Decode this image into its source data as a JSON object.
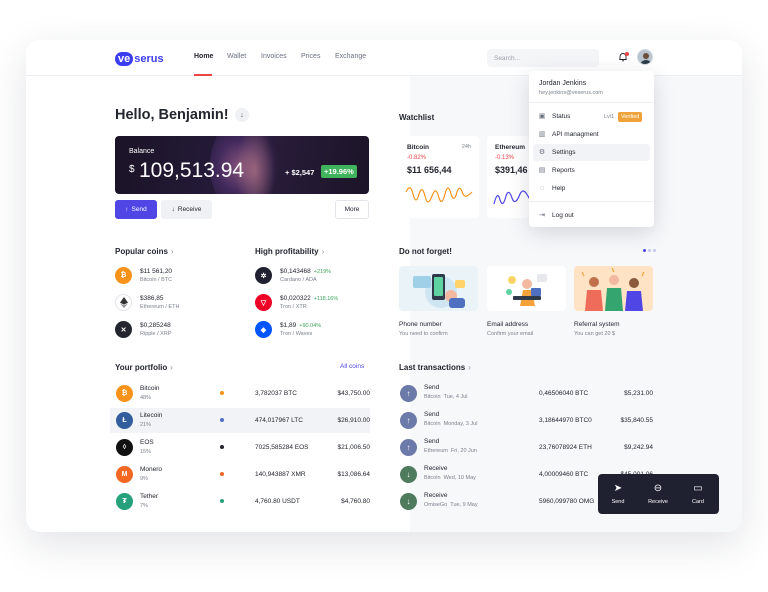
{
  "brand": {
    "logo_badge": "ve",
    "logo_rest": "serus",
    "accent": "#4f46e5"
  },
  "nav": {
    "items": [
      "Home",
      "Wallet",
      "Invoices",
      "Prices",
      "Exchange"
    ],
    "active": "Home"
  },
  "search": {
    "placeholder": "Search..."
  },
  "greeting": "Hello, Benjamin!",
  "balance": {
    "label": "Balance",
    "currency": "$",
    "amount": "109,513.94",
    "change": "+ $2,547",
    "change_pct": "+19.96%"
  },
  "actions": {
    "send": "Send",
    "receive": "Receive",
    "more": "More"
  },
  "popular": {
    "title": "Popular coins",
    "items": [
      {
        "value": "$11 561,20",
        "sub": "Bitcoin / BTC",
        "icon": "bitcoin-icon",
        "color": "#f7931a"
      },
      {
        "value": "$386,85",
        "sub": "Ethereum / ETH",
        "icon": "ethereum-icon",
        "color": "#ffffff"
      },
      {
        "value": "$0,285248",
        "sub": "Ripple / XRP",
        "icon": "ripple-icon",
        "color": "#23262f"
      }
    ]
  },
  "high_profit": {
    "title": "High profitability",
    "items": [
      {
        "value": "$0,143468",
        "gain": "+219%",
        "sub": "Cardano / ADA",
        "icon": "cardano-icon",
        "color": "#1f2130"
      },
      {
        "value": "$0,020322",
        "gain": "+118.16%",
        "sub": "Tron / XTR",
        "icon": "tron-icon",
        "color": "#ef0027"
      },
      {
        "value": "$1,89",
        "gain": "+90.04%",
        "sub": "Tron / Waves",
        "icon": "waves-icon",
        "color": "#0055ff"
      }
    ]
  },
  "portfolio": {
    "title": "Your portfolio",
    "all_link": "All coins",
    "rows": [
      {
        "name": "Bitcoin",
        "pct": "48%",
        "amount": "3,782037 BTC",
        "usd": "$43,750.00",
        "color": "#f7931a",
        "glyph": "₿"
      },
      {
        "name": "Litecoin",
        "pct": "21%",
        "amount": "474,017967 LTC",
        "usd": "$26,910.00",
        "color": "#345d9d",
        "glyph": "Ł"
      },
      {
        "name": "EOS",
        "pct": "15%",
        "amount": "7025,585284 EOS",
        "usd": "$21,006.50",
        "color": "#111111",
        "glyph": "◊"
      },
      {
        "name": "Monero",
        "pct": "9%",
        "amount": "140,943887 XMR",
        "usd": "$13,086.64",
        "color": "#f26822",
        "glyph": "M"
      },
      {
        "name": "Tether",
        "pct": "7%",
        "amount": "4,760.80 USDT",
        "usd": "$4,760.80",
        "color": "#26a17b",
        "glyph": "₮"
      }
    ]
  },
  "watchlist": {
    "title": "Watchlist",
    "cards": [
      {
        "name": "Bitcoin",
        "period": "24h",
        "change": "-0.82%",
        "price": "$11 656,44",
        "line_color": "#f7931a"
      },
      {
        "name": "Ethereum",
        "period": "",
        "change": "-0.13%",
        "price": "$391,46",
        "line_color": "#4f46e5"
      }
    ]
  },
  "dnf": {
    "title": "Do not forget!",
    "cards": [
      {
        "label": "Phone number",
        "sub": "You need to confirm"
      },
      {
        "label": "Email address",
        "sub": "Confirm your email"
      },
      {
        "label": "Referral system",
        "sub": "You can get 20 $"
      }
    ]
  },
  "transactions": {
    "title": "Last transactions",
    "rows": [
      {
        "type": "Send",
        "coin": "Bitcoin",
        "date": "Tue, 4 Jul",
        "amount": "0,46506040 BTC",
        "usd": "$5,231.00",
        "dir": "up"
      },
      {
        "type": "Send",
        "coin": "Bitcoin",
        "date": "Monday, 3 Jul",
        "amount": "3,18644970 BTC0",
        "usd": "$35,840.55",
        "dir": "up"
      },
      {
        "type": "Send",
        "coin": "Ethereum",
        "date": "Fri, 20 Jun",
        "amount": "23,76078924 ETH",
        "usd": "$9,242.94",
        "dir": "up"
      },
      {
        "type": "Receive",
        "coin": "Bitcoin",
        "date": "Wed, 10 May",
        "amount": "4,00009460 BTC",
        "usd": "$45,001.06",
        "dir": "down"
      },
      {
        "type": "Receive",
        "coin": "OmiseGo",
        "date": "Tue, 9 May",
        "amount": "5960,099780 OMG",
        "usd": "",
        "dir": "down"
      }
    ]
  },
  "profile": {
    "name": "Jordan Jenkins",
    "email": "hey.jenkins@veserus.com",
    "menu": [
      {
        "label": "Status",
        "icon": "status-icon",
        "level": "Lvl1",
        "badge": "Verified"
      },
      {
        "label": "API managment",
        "icon": "api-icon"
      },
      {
        "label": "Settings",
        "icon": "gear-icon"
      },
      {
        "label": "Reports",
        "icon": "reports-icon"
      },
      {
        "label": "Help",
        "icon": "help-icon"
      },
      {
        "label": "Log out",
        "icon": "logout-icon"
      }
    ]
  },
  "action_bar": {
    "items": [
      "Send",
      "Receive",
      "Card"
    ]
  }
}
